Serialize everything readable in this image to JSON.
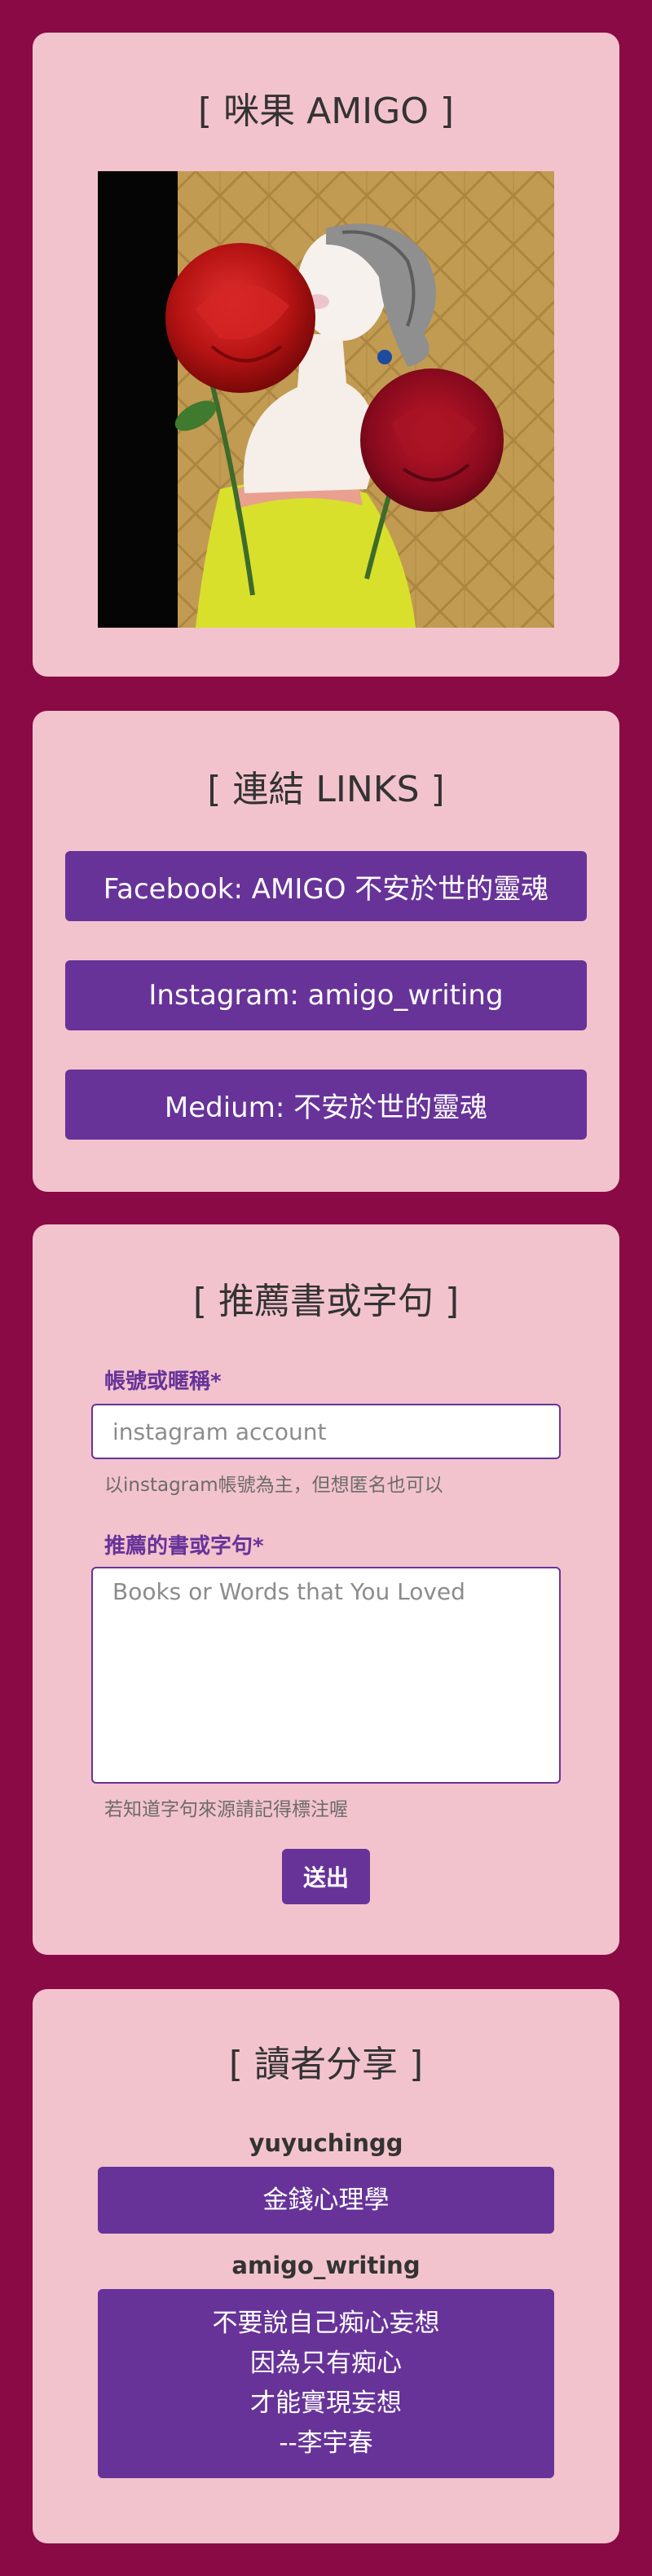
{
  "profile": {
    "title": "[ 咪果 AMIGO ]"
  },
  "links": {
    "title": "[ 連結 LINKS ]",
    "items": [
      {
        "label": "Facebook: AMIGO 不安於世的靈魂"
      },
      {
        "label": "Instagram: amigo_writing"
      },
      {
        "label": "Medium: 不安於世的靈魂"
      }
    ]
  },
  "form": {
    "title": "[ 推薦書或字句 ]",
    "account_label": "帳號或暱稱*",
    "account_placeholder": "instagram account",
    "account_hint": "以instagram帳號為主，但想匿名也可以",
    "words_label": "推薦的書或字句*",
    "words_placeholder": "Books or Words that You Loved",
    "words_hint": "若知道字句來源請記得標注喔",
    "submit_label": "送出"
  },
  "share": {
    "title": "[ 讀者分享 ]",
    "entries": [
      {
        "user": "yuyuchingg",
        "lines": [
          "金錢心理學"
        ]
      },
      {
        "user": "amigo_writing",
        "lines": [
          "不要說自己痴心妄想",
          "因為只有痴心",
          "才能實現妄想",
          "--李宇春"
        ]
      }
    ]
  },
  "colors": {
    "page_background": "#8a0a45",
    "card_background": "#f3c3cd",
    "accent": "#673399"
  }
}
